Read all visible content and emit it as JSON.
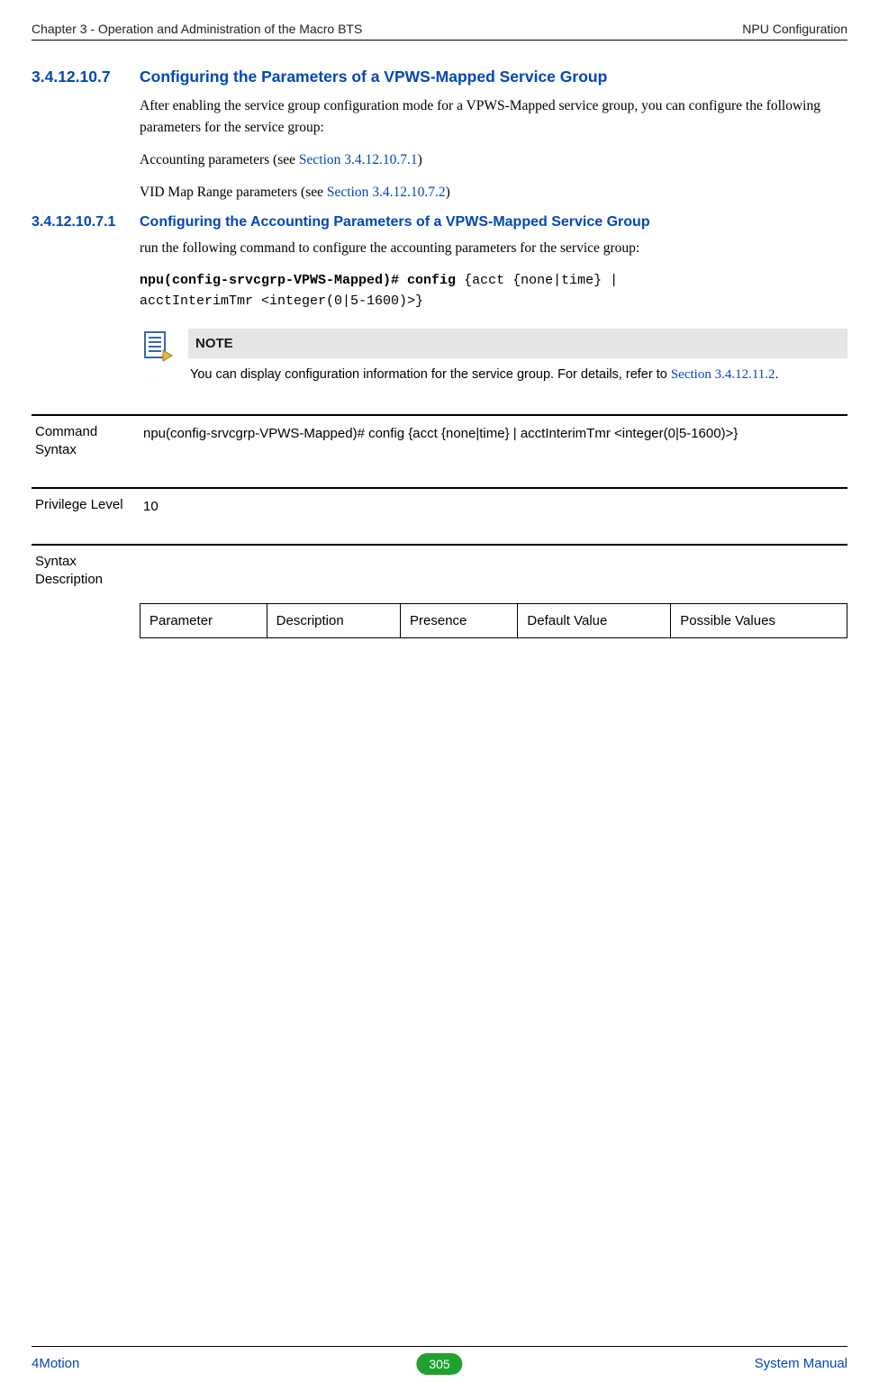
{
  "header": {
    "left": "Chapter 3 - Operation and Administration of the Macro BTS",
    "right": "NPU Configuration"
  },
  "s1": {
    "num": "3.4.12.10.7",
    "title": "Configuring the Parameters of a VPWS-Mapped Service Group",
    "p1": "After enabling the service group configuration mode for a VPWS-Mapped service group, you can configure the following parameters for the service group:",
    "p2_prefix": "Accounting parameters (see ",
    "p2_link": "Section 3.4.12.10.7.1",
    "p2_suffix": ")",
    "p3_prefix": "VID Map Range parameters (see ",
    "p3_link": "Section 3.4.12.10.7.2",
    "p3_suffix": ")"
  },
  "s2": {
    "num": "3.4.12.10.7.1",
    "title": "Configuring the Accounting Parameters of a VPWS-Mapped Service Group",
    "p1": "run the following command to configure the accounting parameters for the service group:",
    "cmd_bold": "npu(config-srvcgrp-VPWS-Mapped)# config",
    "cmd_rest1": " {acct {none|time} | ",
    "cmd_rest2": "acctInterimTmr <integer(0|5-1600)>}"
  },
  "note": {
    "label": "NOTE",
    "text": "You can display configuration information for the service group. For details, refer to ",
    "link": "Section 3.4.12.11.2",
    "suffix": "."
  },
  "definitions": [
    {
      "label": "Command Syntax",
      "value": "npu(config-srvcgrp-VPWS-Mapped)# config {acct {none|time} | acctInterimTmr <integer(0|5-1600)>}"
    },
    {
      "label": "Privilege Level",
      "value": "10"
    },
    {
      "label": "Syntax Description",
      "value": ""
    }
  ],
  "param_headers": [
    "Parameter",
    "Description",
    "Presence",
    "Default Value",
    "Possible Values"
  ],
  "footer": {
    "left": "4Motion",
    "page": "305",
    "right": "System Manual"
  }
}
